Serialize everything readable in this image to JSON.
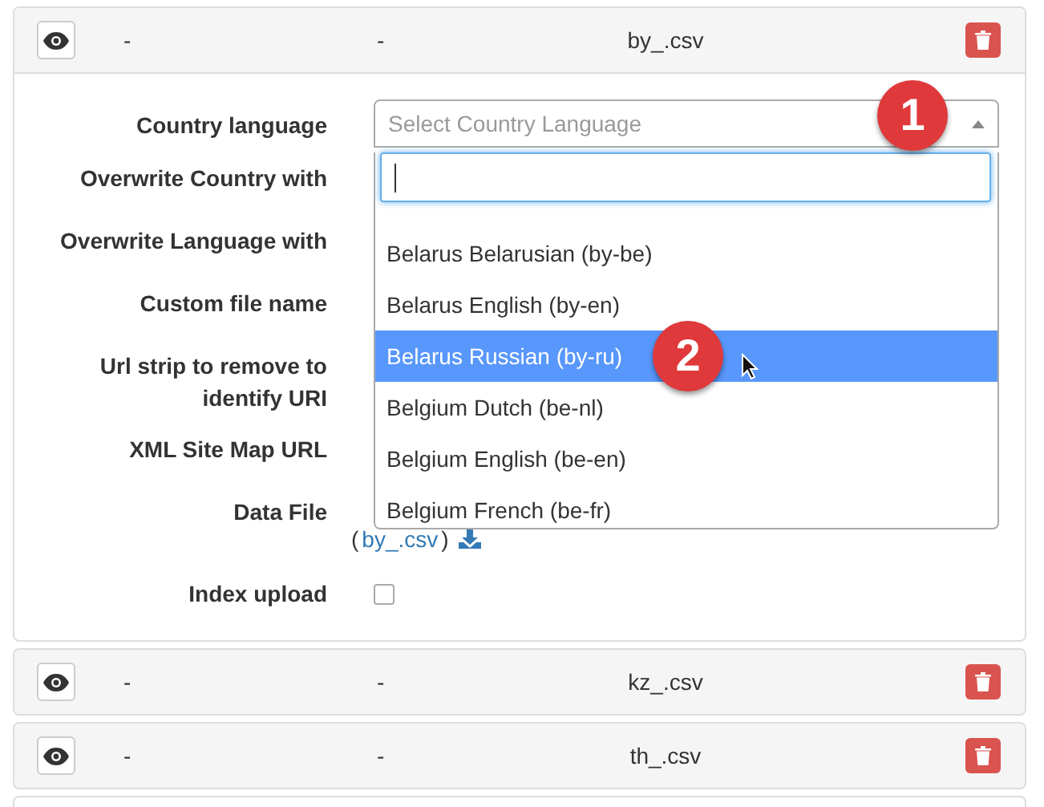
{
  "rows": [
    {
      "column_1": "-",
      "column_2": "-",
      "file": "by_.csv",
      "expanded": true,
      "form": [
        {
          "label": "Country language",
          "kind": "select"
        },
        {
          "label": "Overwrite Country with",
          "kind": "hidden"
        },
        {
          "label": "Overwrite Language with",
          "kind": "hidden"
        },
        {
          "label": "Custom file name",
          "kind": "hidden"
        },
        {
          "label": "Url strip to remove to identify URI",
          "kind": "hidden"
        },
        {
          "label": "XML Site Map URL",
          "kind": "hidden"
        },
        {
          "label": "Data File",
          "kind": "file",
          "link_prefix": "(",
          "link": "by_.csv",
          "link_suffix": ")"
        },
        {
          "label": "Index upload",
          "kind": "checkbox",
          "checked": false
        }
      ]
    },
    {
      "column_1": "-",
      "column_2": "-",
      "file": "kz_.csv",
      "expanded": false
    },
    {
      "column_1": "-",
      "column_2": "-",
      "file": "th_.csv",
      "expanded": false
    }
  ],
  "dropdown": {
    "placeholder": "Select Country Language",
    "open": true,
    "search_focused": true,
    "options": [
      {
        "label": "Belarus Belarusian (by-be)",
        "selected": false
      },
      {
        "label": "Belarus English (by-en)",
        "selected": false
      },
      {
        "label": "Belarus Russian (by-ru)",
        "selected": true
      },
      {
        "label": "Belgium Dutch (be-nl)",
        "selected": false
      },
      {
        "label": "Belgium English (be-en)",
        "selected": false
      },
      {
        "label": "Belgium French (be-fr)",
        "selected": false
      }
    ]
  },
  "markers": [
    {
      "label": "1"
    },
    {
      "label": "2"
    }
  ]
}
